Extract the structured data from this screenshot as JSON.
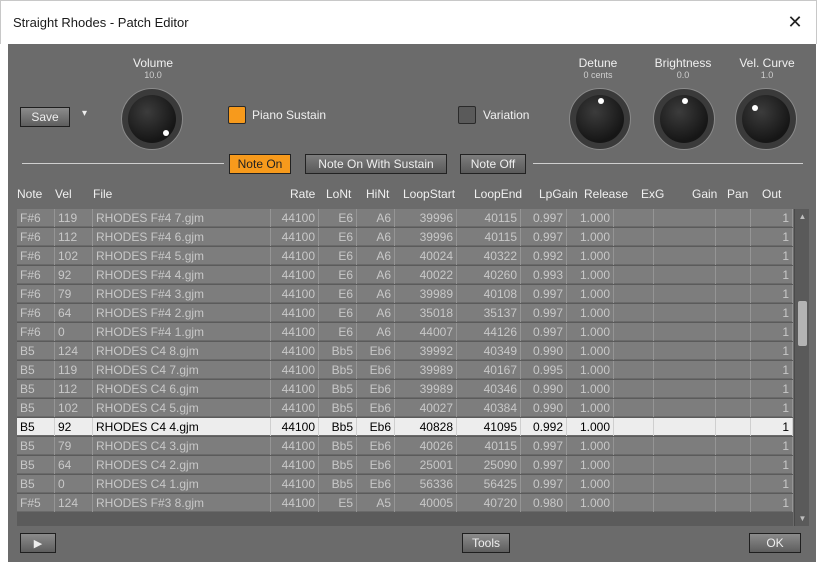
{
  "window": {
    "title": "Straight Rhodes - Patch Editor",
    "close_glyph": "✕"
  },
  "toolbar": {
    "save_label": "Save",
    "save_dropdown_glyph": "▾"
  },
  "knobs": {
    "volume": {
      "label": "Volume",
      "value": "10.0"
    },
    "detune": {
      "label": "Detune",
      "value": "0 cents"
    },
    "brightness": {
      "label": "Brightness",
      "value": "0.0"
    },
    "vel_curve": {
      "label": "Vel. Curve",
      "value": "1.0"
    }
  },
  "options": {
    "piano_sustain": {
      "label": "Piano Sustain",
      "checked": true,
      "color": "#f79a1c"
    },
    "variation": {
      "label": "Variation",
      "checked": false
    }
  },
  "tabs": [
    {
      "label": "Note On",
      "active": true
    },
    {
      "label": "Note On With Sustain",
      "active": false
    },
    {
      "label": "Note Off",
      "active": false
    }
  ],
  "columns": [
    "Note",
    "Vel",
    "File",
    "Rate",
    "LoNt",
    "HiNt",
    "LoopStart",
    "LoopEnd",
    "LpGain",
    "Release",
    "ExG",
    "Gain",
    "Pan",
    "Out"
  ],
  "rows": [
    [
      "F#6",
      "119",
      "RHODES F#4 7.gjm",
      "44100",
      "E6",
      "A6",
      "39996",
      "40115",
      "0.997",
      "1.000",
      "",
      "",
      "",
      "1"
    ],
    [
      "F#6",
      "112",
      "RHODES F#4 6.gjm",
      "44100",
      "E6",
      "A6",
      "39996",
      "40115",
      "0.997",
      "1.000",
      "",
      "",
      "",
      "1"
    ],
    [
      "F#6",
      "102",
      "RHODES F#4 5.gjm",
      "44100",
      "E6",
      "A6",
      "40024",
      "40322",
      "0.992",
      "1.000",
      "",
      "",
      "",
      "1"
    ],
    [
      "F#6",
      "92",
      "RHODES F#4 4.gjm",
      "44100",
      "E6",
      "A6",
      "40022",
      "40260",
      "0.993",
      "1.000",
      "",
      "",
      "",
      "1"
    ],
    [
      "F#6",
      "79",
      "RHODES F#4 3.gjm",
      "44100",
      "E6",
      "A6",
      "39989",
      "40108",
      "0.997",
      "1.000",
      "",
      "",
      "",
      "1"
    ],
    [
      "F#6",
      "64",
      "RHODES F#4 2.gjm",
      "44100",
      "E6",
      "A6",
      "35018",
      "35137",
      "0.997",
      "1.000",
      "",
      "",
      "",
      "1"
    ],
    [
      "F#6",
      "0",
      "RHODES F#4 1.gjm",
      "44100",
      "E6",
      "A6",
      "44007",
      "44126",
      "0.997",
      "1.000",
      "",
      "",
      "",
      "1"
    ],
    [
      "B5",
      "124",
      "RHODES C4 8.gjm",
      "44100",
      "Bb5",
      "Eb6",
      "39992",
      "40349",
      "0.990",
      "1.000",
      "",
      "",
      "",
      "1"
    ],
    [
      "B5",
      "119",
      "RHODES C4 7.gjm",
      "44100",
      "Bb5",
      "Eb6",
      "39989",
      "40167",
      "0.995",
      "1.000",
      "",
      "",
      "",
      "1"
    ],
    [
      "B5",
      "112",
      "RHODES C4 6.gjm",
      "44100",
      "Bb5",
      "Eb6",
      "39989",
      "40346",
      "0.990",
      "1.000",
      "",
      "",
      "",
      "1"
    ],
    [
      "B5",
      "102",
      "RHODES C4 5.gjm",
      "44100",
      "Bb5",
      "Eb6",
      "40027",
      "40384",
      "0.990",
      "1.000",
      "",
      "",
      "",
      "1"
    ],
    [
      "B5",
      "92",
      "RHODES C4 4.gjm",
      "44100",
      "Bb5",
      "Eb6",
      "40828",
      "41095",
      "0.992",
      "1.000",
      "",
      "",
      "",
      "1"
    ],
    [
      "B5",
      "79",
      "RHODES C4 3.gjm",
      "44100",
      "Bb5",
      "Eb6",
      "40026",
      "40115",
      "0.997",
      "1.000",
      "",
      "",
      "",
      "1"
    ],
    [
      "B5",
      "64",
      "RHODES C4 2.gjm",
      "44100",
      "Bb5",
      "Eb6",
      "25001",
      "25090",
      "0.997",
      "1.000",
      "",
      "",
      "",
      "1"
    ],
    [
      "B5",
      "0",
      "RHODES C4 1.gjm",
      "44100",
      "Bb5",
      "Eb6",
      "56336",
      "56425",
      "0.997",
      "1.000",
      "",
      "",
      "",
      "1"
    ],
    [
      "F#5",
      "124",
      "RHODES F#3 8.gjm",
      "44100",
      "E5",
      "A5",
      "40005",
      "40720",
      "0.980",
      "1.000",
      "",
      "",
      "",
      "1"
    ]
  ],
  "selected_row": 11,
  "footer": {
    "play_glyph": "▶",
    "tools_label": "Tools",
    "ok_label": "OK"
  },
  "colors": {
    "panel": "#6b6b6b",
    "active_tab": "#f79a1c",
    "selected_row": "#ededed"
  }
}
